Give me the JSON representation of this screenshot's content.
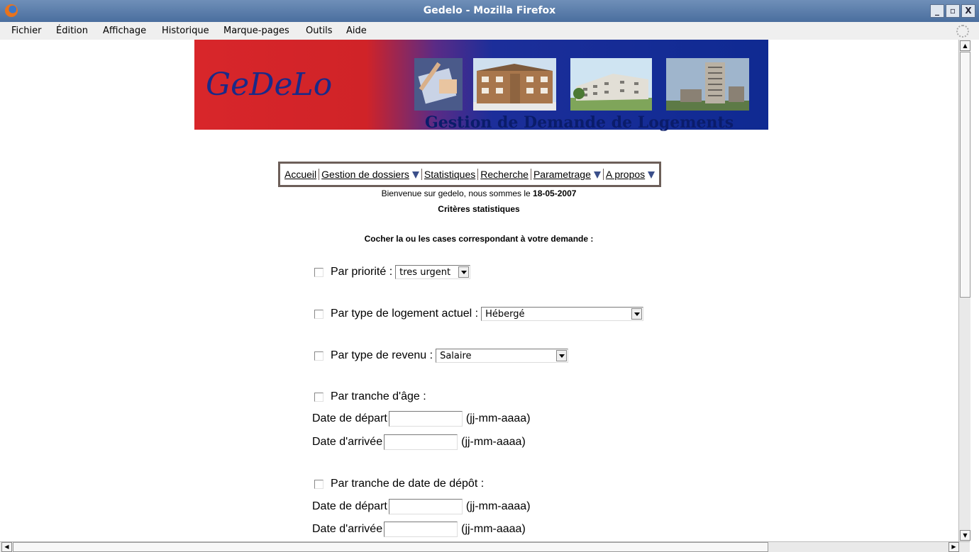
{
  "window": {
    "title": "Gedelo - Mozilla Firefox",
    "buttons": [
      "_",
      "▫",
      "X"
    ]
  },
  "menu": [
    "Fichier",
    "Édition",
    "Affichage",
    "Historique",
    "Marque-pages",
    "Outils",
    "Aide"
  ],
  "banner": {
    "logo": "GeDeLo",
    "tagline": "Gestion de Demande de Logements"
  },
  "nav": {
    "items": [
      {
        "label": "Accueil"
      },
      {
        "label": "Gestion de dossiers"
      },
      {
        "label": "Statistiques"
      },
      {
        "label": "Recherche"
      },
      {
        "label": "Parametrage"
      },
      {
        "label": "A propos"
      }
    ]
  },
  "welcome": {
    "text": "Bienvenue sur gedelo, nous sommes le ",
    "date": "18-05-2007"
  },
  "page_title": "Critères statistiques",
  "instruction": "Cocher la ou les cases correspondant à votre demande :",
  "criteria": {
    "priority": {
      "label": "Par priorité :",
      "value": "tres urgent"
    },
    "housing": {
      "label": "Par type de logement actuel :",
      "value": "Hébergé"
    },
    "income": {
      "label": "Par type de revenu :",
      "value": "Salaire"
    },
    "age": {
      "label": "Par tranche d'âge :",
      "start_label": "Date de départ",
      "end_label": "Date d'arrivée",
      "hint": "(jj-mm-aaaa)"
    },
    "deposit": {
      "label": "Par tranche de date de dépôt :",
      "start_label": "Date de départ",
      "end_label": "Date d'arrivée",
      "hint": "(jj-mm-aaaa)"
    }
  }
}
